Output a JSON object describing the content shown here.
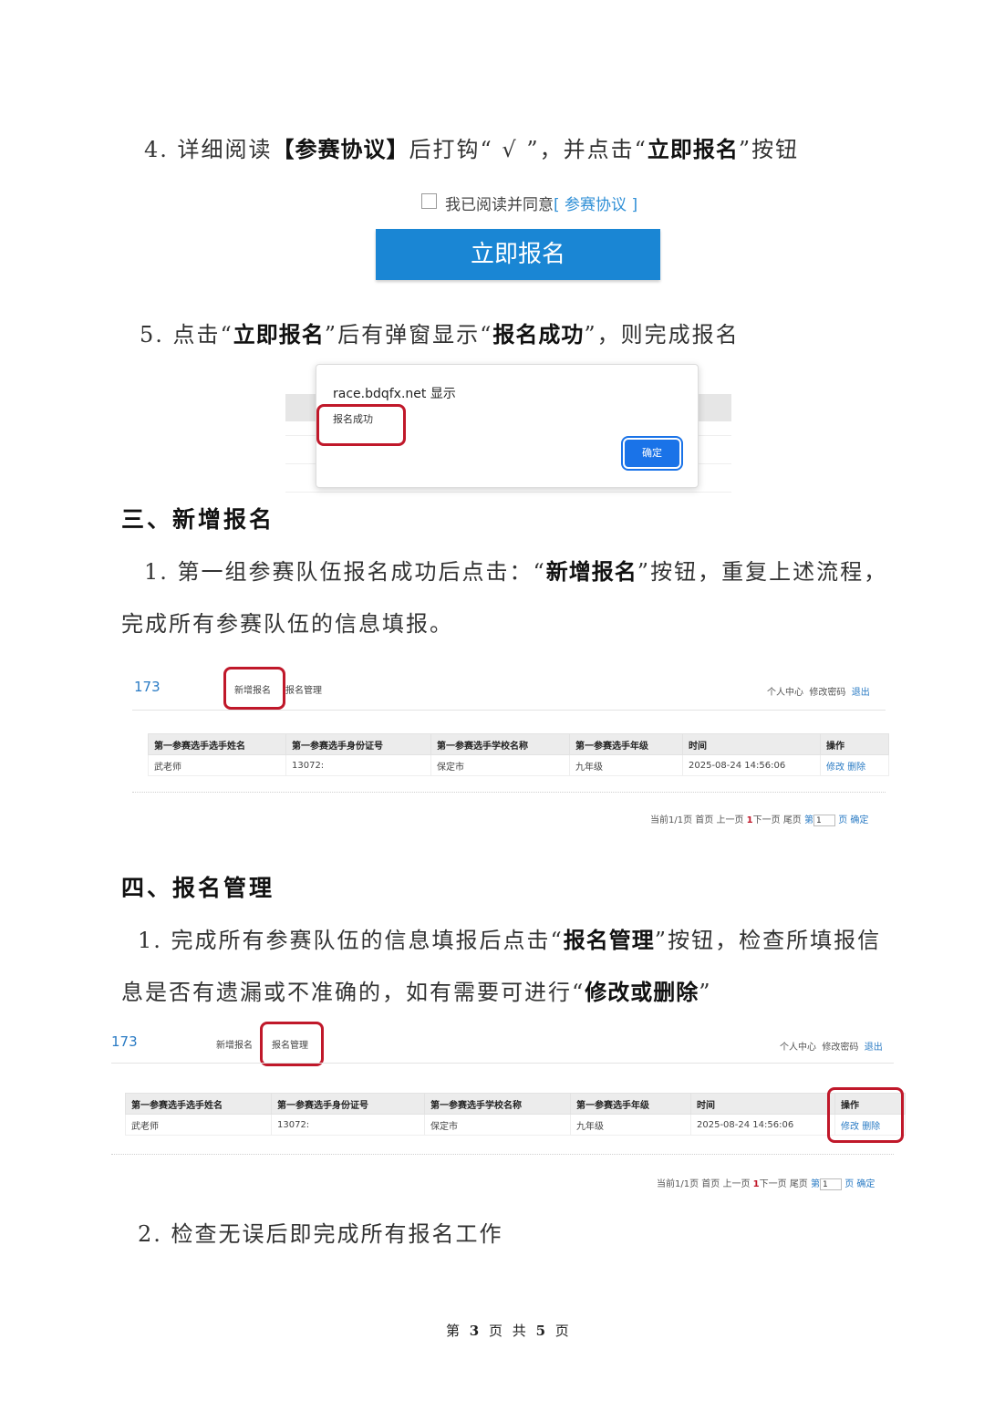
{
  "step4": {
    "prefix": "4. 详细阅读",
    "bold1": "【参赛协议】",
    "mid": "后打钩“ √ ”，并点击“",
    "bold2": "立即报名",
    "suffix": "”按钮"
  },
  "agreement": {
    "text": "我已阅读并同意",
    "link": "[ 参赛协议 ]",
    "button": "立即报名"
  },
  "step5": {
    "prefix": "5. 点击“",
    "bold1": "立即报名",
    "mid": "”后有弹窗显示“",
    "bold2": "报名成功",
    "suffix": "”，则完成报名"
  },
  "dialog": {
    "title": "race.bdqfx.net 显示",
    "message": "报名成功",
    "ok": "确定"
  },
  "section3": {
    "heading": "三、新增报名",
    "line1_prefix": "1. 第一组参赛队伍报名成功后点击：“",
    "line1_bold": "新增报名",
    "line1_suffix": "”按钮，重复上述流程，",
    "line2": "完成所有参赛队伍的信息填报。"
  },
  "app": {
    "logo": "173",
    "nav": [
      "新增报名",
      "报名管理"
    ],
    "right": [
      "个人中心",
      "修改密码",
      "退出"
    ],
    "columns": [
      "第一参赛选手选手姓名",
      "第一参赛选手身份证号",
      "第一参赛选手学校名称",
      "第一参赛选手年级",
      "时间",
      "操作"
    ],
    "rows": [
      [
        "武老师",
        "13072:",
        "保定市",
        "九年级",
        "2025-08-24 14:56:06"
      ]
    ],
    "ops": [
      "修改",
      "删除"
    ],
    "pager": {
      "info": "当前1/1页",
      "first": "首页",
      "prev": "上一页",
      "current": "1",
      "next": "下一页",
      "last": "尾页",
      "goto_prefix": "第",
      "goto_value": "1",
      "goto_suffix": "页",
      "confirm": "确定"
    }
  },
  "section4": {
    "heading": "四、报名管理",
    "line1_prefix": "1. 完成所有参赛队伍的信息填报后点击“",
    "line1_bold": "报名管理",
    "line1_suffix": "”按钮，检查所填报信",
    "line2_prefix": "息是否有遗漏或不准确的，如有需要可进行“",
    "line2_bold": "修改或删除",
    "line2_suffix": "”",
    "step2": "2. 检查无误后即完成所有报名工作"
  },
  "footer": {
    "prefix": "第",
    "page": "3",
    "mid": "页 共",
    "total": "5",
    "suffix": "页"
  }
}
